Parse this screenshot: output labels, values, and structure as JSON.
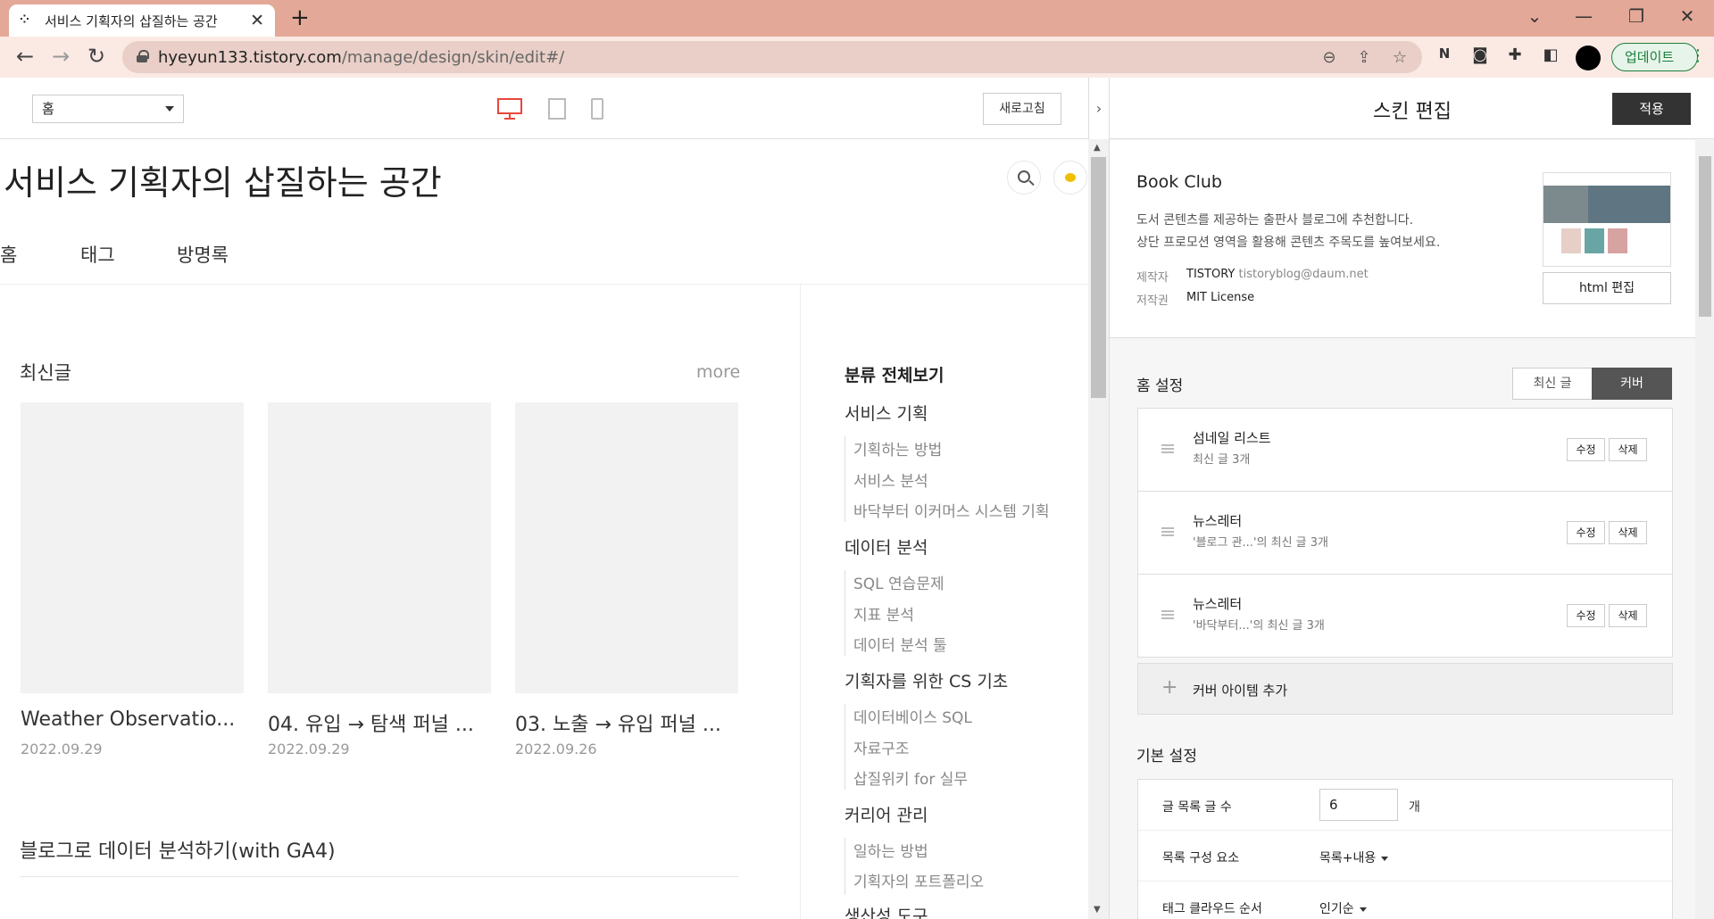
{
  "browser": {
    "tab_title": "서비스 기획자의 삽질하는 공간",
    "tab_close": "✕",
    "new_tab": "+",
    "window_controls": [
      "⌄",
      "—",
      "❐",
      "✕"
    ],
    "url_host": "hyeyun133.tistory.com",
    "url_path": "/manage/design/skin/edit#/",
    "update_label": "업데이트",
    "icons": [
      "back-icon",
      "forward-icon",
      "reload-icon",
      "lock-icon",
      "zoom-out-icon",
      "share-icon",
      "star-icon",
      "notion-icon",
      "camera-icon",
      "puzzle-icon",
      "sidepanel-icon",
      "profile-avatar",
      "more-icon"
    ]
  },
  "preview_header": {
    "page_select": "홈",
    "refresh_label": "새로고침",
    "collapse": "›",
    "devices": [
      "desktop-icon",
      "tablet-icon",
      "mobile-icon"
    ],
    "accent_color": "#e8473d"
  },
  "blog": {
    "title": "서비스 기획자의 삽질하는 공간",
    "nav": [
      "홈",
      "태그",
      "방명록"
    ],
    "recent_title": "최신글",
    "more": "more",
    "posts": [
      {
        "title": "Weather Observatio...",
        "date": "2022.09.29"
      },
      {
        "title": "04. 유입 → 탐색 퍼널 ...",
        "date": "2022.09.29"
      },
      {
        "title": "03. 노출 → 유입 퍼널 ...",
        "date": "2022.09.26"
      }
    ],
    "section2_title": "블로그로 데이터 분석하기(with GA4)",
    "categories_all": "분류 전체보기",
    "categories": [
      {
        "name": "서비스 기획",
        "subs": [
          "기획하는 방법",
          "서비스 분석",
          "바닥부터 이커머스 시스템 기획"
        ]
      },
      {
        "name": "데이터 분석",
        "subs": [
          "SQL 연습문제",
          "지표 분석",
          "데이터 분석 툴"
        ]
      },
      {
        "name": "기획자를 위한 CS 기초",
        "subs": [
          "데이터베이스 SQL",
          "자료구조",
          "삽질위키 for 실무"
        ]
      },
      {
        "name": "커리어 관리",
        "subs": [
          "일하는 방법",
          "기획자의 포트폴리오"
        ]
      },
      {
        "name": "생산성 도구",
        "subs": []
      }
    ]
  },
  "panel": {
    "title": "스킨 편집",
    "apply_label": "적용",
    "skin_name": "Book Club",
    "skin_desc1": "도서 콘텐츠를 제공하는 출판사 블로그에 추천합니다.",
    "skin_desc2": "상단 프로모션 영역을 활용해 콘텐츠 주목도를 높여보세요.",
    "maker_key": "제작자",
    "maker_name": "TISTORY",
    "maker_email": "tistoryblog@daum.net",
    "license_key": "저작권",
    "license_value": "MIT License",
    "html_edit_label": "html 편집",
    "home_settings_label": "홈 설정",
    "seg_recent": "최신 글",
    "seg_cover": "커버",
    "cover_items": [
      {
        "title": "섬네일 리스트",
        "sub": "최신 글 3개"
      },
      {
        "title": "뉴스레터",
        "sub": "'블로그 관...'의 최신 글 3개"
      },
      {
        "title": "뉴스레터",
        "sub": "'바닥부터...'의 최신 글 3개"
      }
    ],
    "edit_label": "수정",
    "delete_label": "삭제",
    "add_cover_label": "커버 아이템 추가",
    "basic_settings_label": "기본 설정",
    "post_count_label": "글 목록 글 수",
    "post_count_value": "6",
    "post_count_unit": "개",
    "list_elements_label": "목록 구성 요소",
    "list_elements_value": "목록+내용",
    "tag_order_label": "태그 클라우드 순서",
    "tag_order_value": "인기순"
  }
}
